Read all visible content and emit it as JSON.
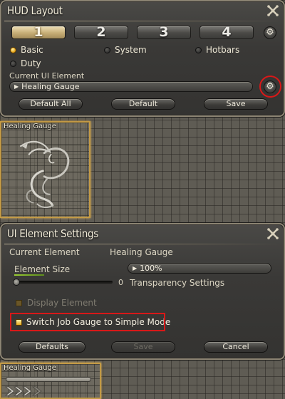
{
  "hud_layout": {
    "title": "HUD Layout",
    "tabs": [
      "1",
      "2",
      "3",
      "4"
    ],
    "active_tab": "1",
    "filters": [
      {
        "label": "Basic",
        "selected": true
      },
      {
        "label": "System",
        "selected": false
      },
      {
        "label": "Hotbars",
        "selected": false
      },
      {
        "label": "Duty",
        "selected": false
      }
    ],
    "current_label": "Current UI Element",
    "current_value": "Healing Gauge",
    "buttons": {
      "default_all": "Default All",
      "default": "Default",
      "save": "Save"
    }
  },
  "preview_top": {
    "label": "Healing Gauge"
  },
  "ui_settings": {
    "title": "UI Element Settings",
    "current_element_label": "Current Element",
    "current_element_value": "Healing Gauge",
    "size_label": "Element Size",
    "size_value": "100%",
    "transparency_value": "0",
    "transparency_label": "Transparency Settings",
    "display_element_label": "Display Element",
    "simple_mode_label": "Switch Job Gauge to Simple Mode",
    "buttons": {
      "defaults": "Defaults",
      "save": "Save",
      "cancel": "Cancel"
    }
  },
  "preview_bottom": {
    "label": "Healing Gauge"
  },
  "colors": {
    "accent_gold": "#c39a45",
    "highlight_red": "#d81818"
  }
}
